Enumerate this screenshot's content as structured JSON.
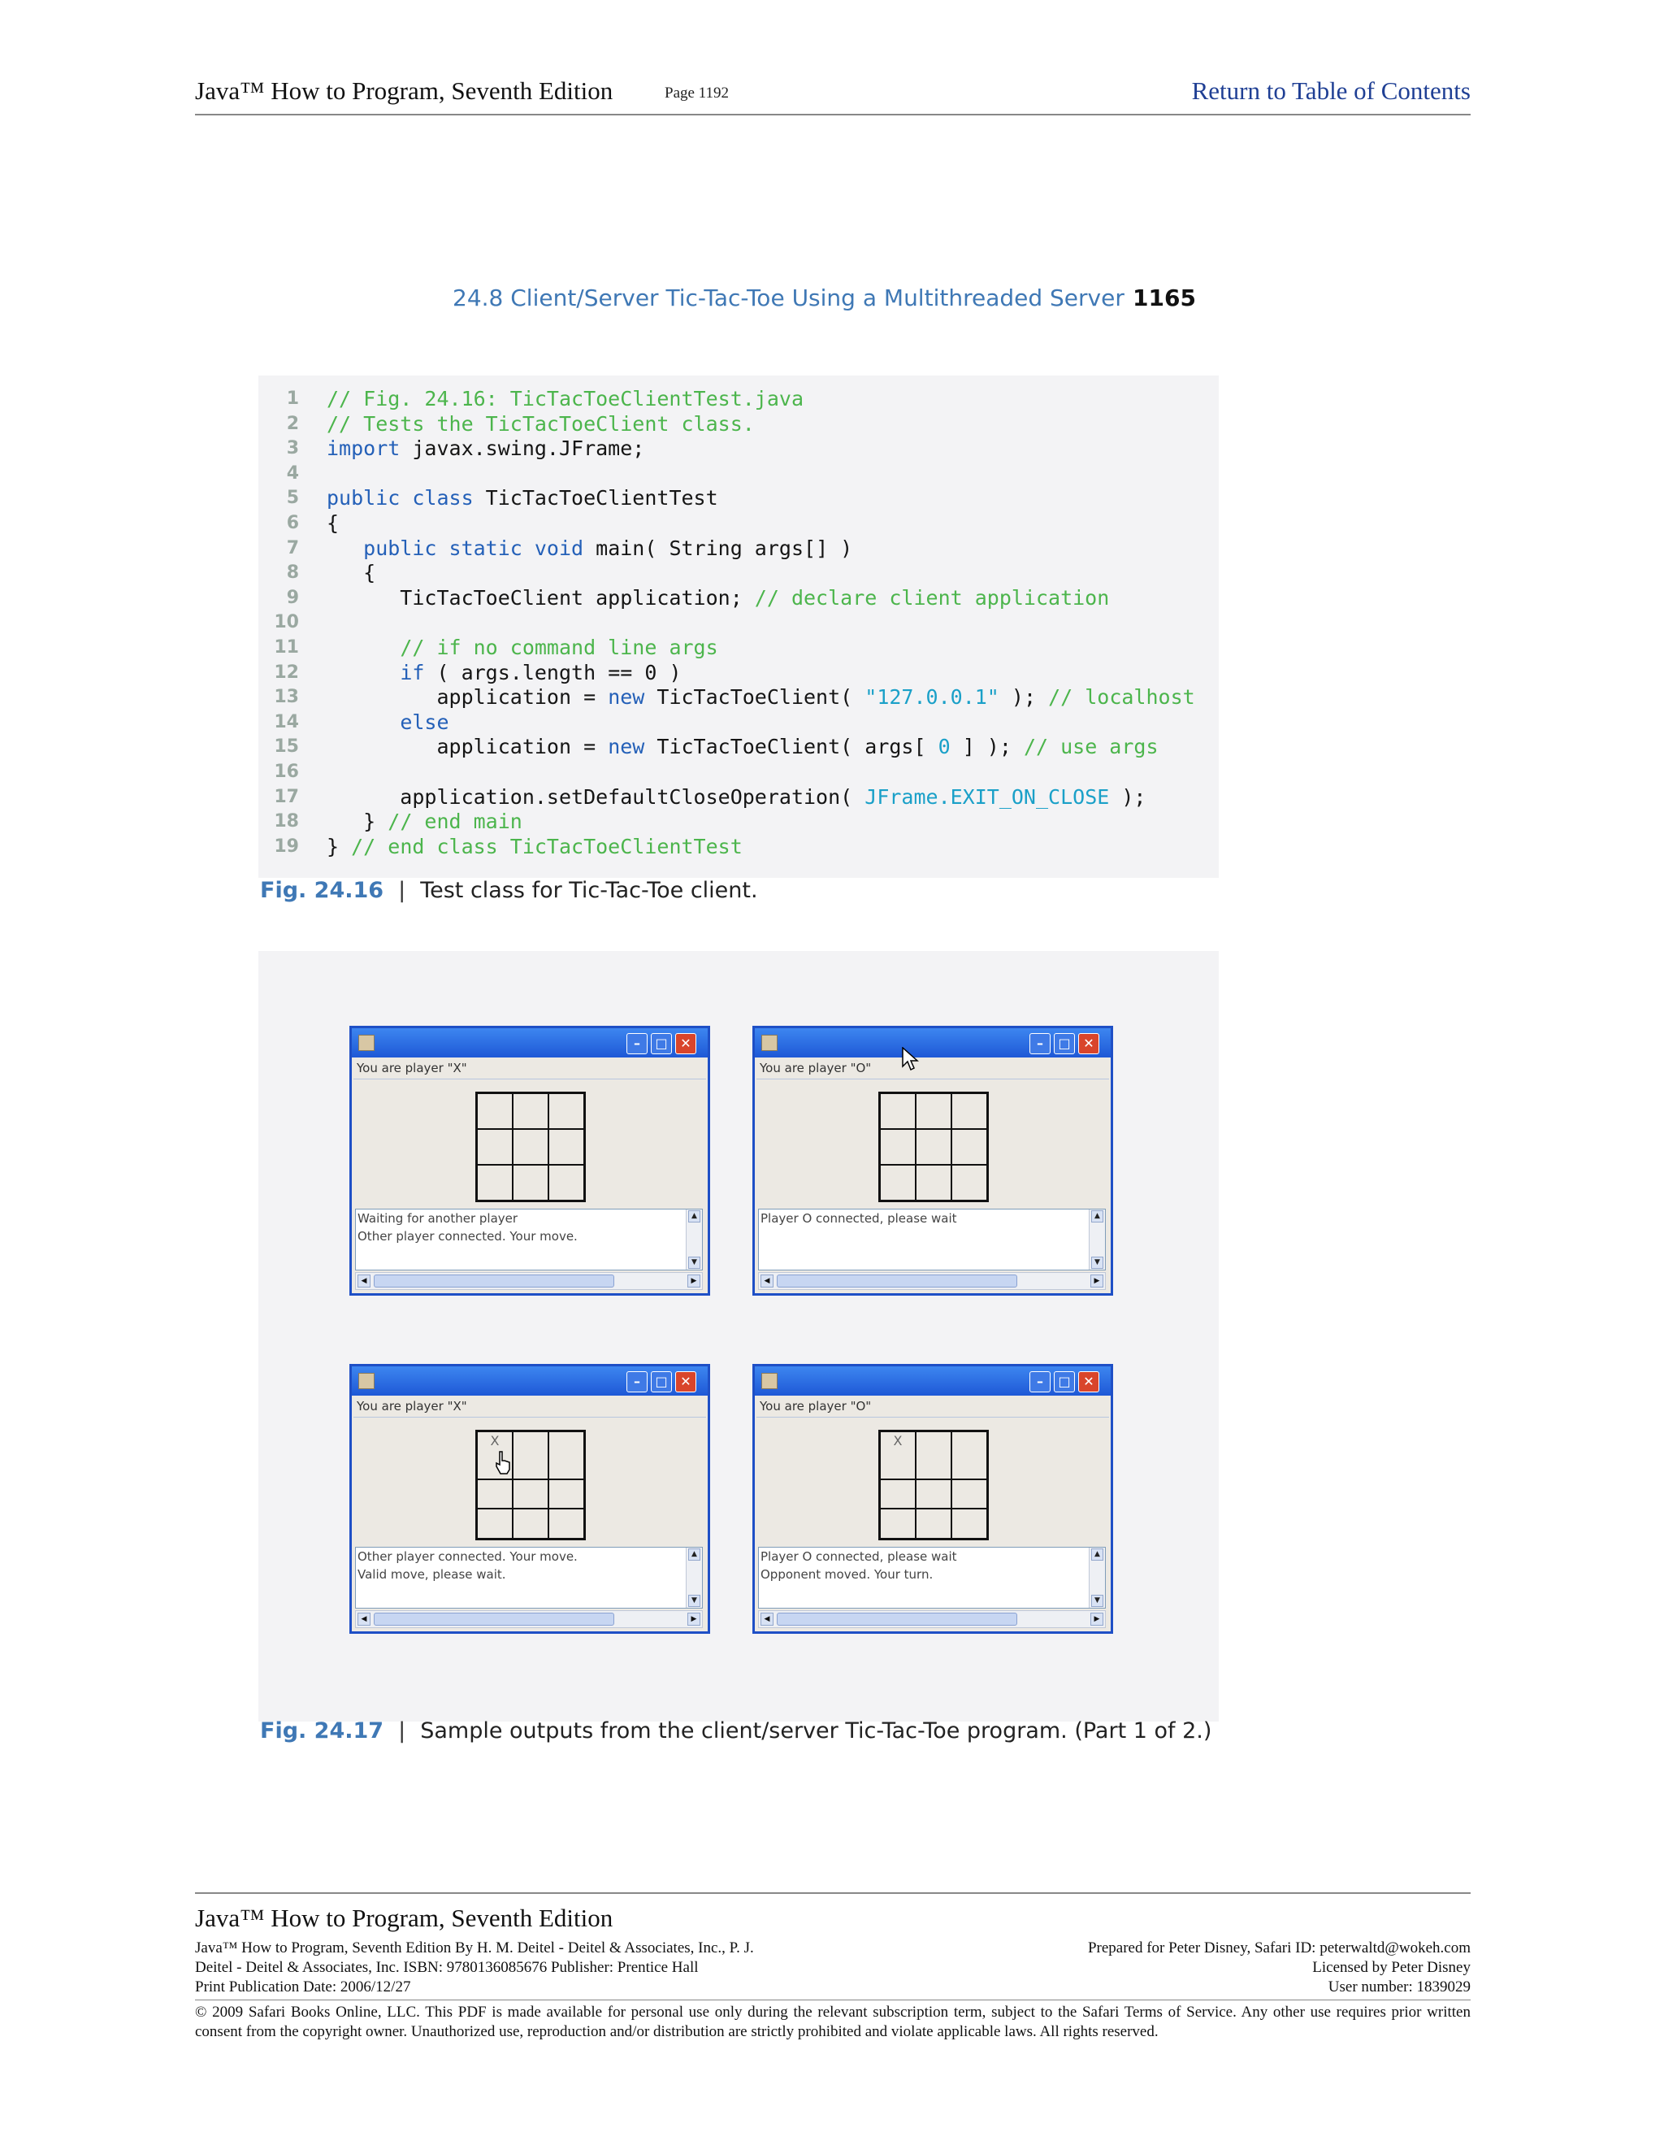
{
  "header": {
    "book_title": "Java™ How to Program, Seventh Edition",
    "page": "Page 1192",
    "toc_link": "Return to Table of Contents"
  },
  "running_head": {
    "section": "24.8   Client/Server Tic-Tac-Toe Using a Multithreaded Server",
    "page_number": "1165"
  },
  "code": {
    "lines": [
      [
        [
          "cmt",
          "// Fig. 24.16: TicTacToeClientTest.java"
        ]
      ],
      [
        [
          "cmt",
          "// Tests the TicTacToeClient class."
        ]
      ],
      [
        [
          "kw",
          "import"
        ],
        [
          "plain",
          " javax.swing.JFrame;"
        ]
      ],
      [],
      [
        [
          "kw",
          "public class"
        ],
        [
          "plain",
          " TicTacToeClientTest"
        ]
      ],
      [
        [
          "plain",
          "{"
        ]
      ],
      [
        [
          "plain",
          "   "
        ],
        [
          "kw",
          "public static void"
        ],
        [
          "plain",
          " main( String args[] )"
        ]
      ],
      [
        [
          "plain",
          "   {"
        ]
      ],
      [
        [
          "plain",
          "      TicTacToeClient application; "
        ],
        [
          "cmt",
          "// declare client application"
        ]
      ],
      [],
      [
        [
          "plain",
          "      "
        ],
        [
          "cmt",
          "// if no command line args"
        ]
      ],
      [
        [
          "plain",
          "      "
        ],
        [
          "kw",
          "if"
        ],
        [
          "plain",
          " ( args.length == 0 )"
        ]
      ],
      [
        [
          "plain",
          "         application = "
        ],
        [
          "kw",
          "new"
        ],
        [
          "plain",
          " TicTacToeClient( "
        ],
        [
          "str",
          "\"127.0.0.1\""
        ],
        [
          "plain",
          " ); "
        ],
        [
          "cmt",
          "// localhost"
        ]
      ],
      [
        [
          "plain",
          "      "
        ],
        [
          "kw",
          "else"
        ]
      ],
      [
        [
          "plain",
          "         application = "
        ],
        [
          "kw",
          "new"
        ],
        [
          "plain",
          " TicTacToeClient( args[ "
        ],
        [
          "str",
          "0"
        ],
        [
          "plain",
          " ] ); "
        ],
        [
          "cmt",
          "// use args"
        ]
      ],
      [],
      [
        [
          "plain",
          "      application.setDefaultCloseOperation( "
        ],
        [
          "const",
          "JFrame.EXIT_ON_CLOSE"
        ],
        [
          "plain",
          " );"
        ]
      ],
      [
        [
          "plain",
          "   } "
        ],
        [
          "cmt",
          "// end main"
        ]
      ],
      [
        [
          "plain",
          "} "
        ],
        [
          "cmt",
          "// end class TicTacToeClientTest"
        ]
      ]
    ]
  },
  "fig_1616": {
    "label": "Fig. 24.16",
    "sep": "|",
    "text": "Test class for Tic-Tac-Toe client."
  },
  "fig_1617": {
    "label": "Fig. 24.17",
    "sep": "|",
    "text": "Sample outputs from the client/server Tic-Tac-Toe program. (Part 1 of 2.)"
  },
  "windows": [
    {
      "player": "You are player \"X\"",
      "cells": [
        "",
        "",
        "",
        "",
        "",
        "",
        "",
        "",
        ""
      ],
      "messages": [
        "Waiting for another player",
        "Other player connected. Your move."
      ]
    },
    {
      "player": "You are player \"O\"",
      "cells": [
        "",
        "",
        "",
        "",
        "",
        "",
        "",
        "",
        ""
      ],
      "messages": [
        "Player O connected, please wait"
      ]
    },
    {
      "player": "You are player \"X\"",
      "cells": [
        "X",
        "",
        "",
        "",
        "",
        "",
        "",
        "",
        ""
      ],
      "messages": [
        "Other player connected. Your move.",
        "Valid move, please wait."
      ]
    },
    {
      "player": "You are player \"O\"",
      "cells": [
        "X",
        "",
        "",
        "",
        "",
        "",
        "",
        "",
        ""
      ],
      "messages": [
        "Player O connected, please wait",
        "Opponent moved. Your turn."
      ]
    }
  ],
  "window_controls": {
    "minimize": "–",
    "maximize": "□",
    "close": "✕",
    "scroll_up": "▲",
    "scroll_down": "▼",
    "scroll_left": "◀",
    "scroll_right": "▶"
  },
  "footer": {
    "title": "Java™ How to Program, Seventh Edition",
    "left_lines": [
      "Java™ How to Program, Seventh Edition By H. M. Deitel - Deitel & Associates, Inc., P. J.",
      "Deitel - Deitel & Associates, Inc. ISBN: 9780136085676 Publisher: Prentice Hall",
      "Print Publication Date: 2006/12/27"
    ],
    "right_lines": [
      "Prepared for Peter Disney, Safari ID: peterwaltd@wokeh.com",
      "Licensed by Peter Disney",
      "User number: 1839029"
    ],
    "copyright": "© 2009 Safari Books Online, LLC. This PDF is made available for personal use only during the relevant subscription term, subject to the Safari Terms of Service. Any other use requires prior written consent from the copyright owner. Unauthorized use, reproduction and/or distribution are strictly prohibited and violate applicable laws. All rights reserved."
  }
}
